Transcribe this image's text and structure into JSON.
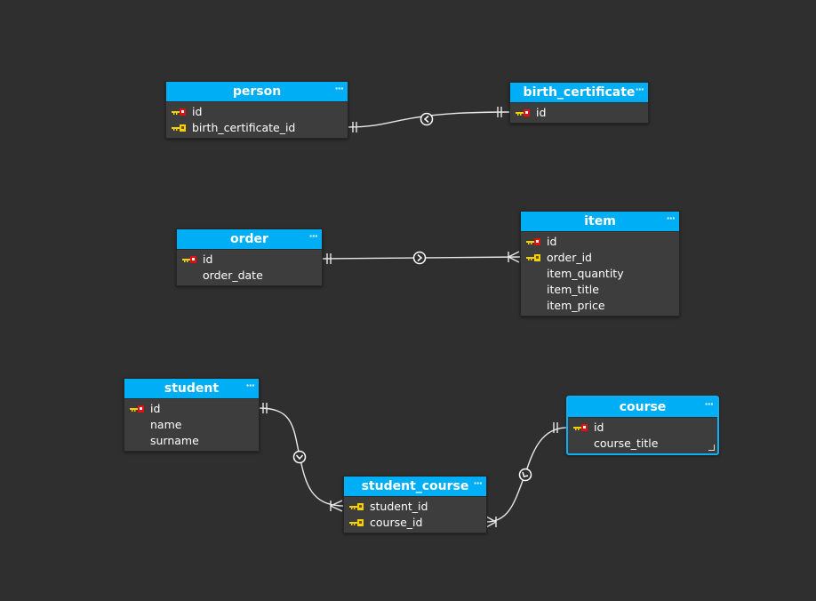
{
  "colors": {
    "background": "#2f2f2f",
    "table_header": "#00aef5",
    "table_body": "#3d3d3d",
    "primary_key": "#e01010",
    "foreign_key": "#f5d000",
    "selection": "#12aff0"
  },
  "tables": {
    "person": {
      "name": "person",
      "menu": "···",
      "columns": [
        {
          "name": "id",
          "key": "primary-key"
        },
        {
          "name": "birth_certificate_id",
          "key": "foreign-key"
        }
      ]
    },
    "birth_certificate": {
      "name": "birth_certificate",
      "menu": "···",
      "columns": [
        {
          "name": "id",
          "key": "primary-key"
        }
      ]
    },
    "order": {
      "name": "order",
      "menu": "···",
      "columns": [
        {
          "name": "id",
          "key": "primary-key"
        },
        {
          "name": "order_date",
          "key": ""
        }
      ]
    },
    "item": {
      "name": "item",
      "menu": "···",
      "columns": [
        {
          "name": "id",
          "key": "primary-key"
        },
        {
          "name": "order_id",
          "key": "foreign-key"
        },
        {
          "name": "item_quantity",
          "key": ""
        },
        {
          "name": "item_title",
          "key": ""
        },
        {
          "name": "item_price",
          "key": ""
        }
      ]
    },
    "student": {
      "name": "student",
      "menu": "···",
      "columns": [
        {
          "name": "id",
          "key": "primary-key"
        },
        {
          "name": "name",
          "key": ""
        },
        {
          "name": "surname",
          "key": ""
        }
      ]
    },
    "course": {
      "name": "course",
      "menu": "···",
      "selected": true,
      "columns": [
        {
          "name": "id",
          "key": "primary-key"
        },
        {
          "name": "course_title",
          "key": ""
        }
      ]
    },
    "student_course": {
      "name": "student_course",
      "menu": "···",
      "columns": [
        {
          "name": "student_id",
          "key": "foreign-key"
        },
        {
          "name": "course_id",
          "key": "foreign-key"
        }
      ]
    }
  },
  "relationships": [
    {
      "from": "person.birth_certificate_id",
      "to": "birth_certificate.id",
      "from_cardinality": "one",
      "to_cardinality": "one",
      "direction": "left"
    },
    {
      "from": "order.id",
      "to": "item.order_id",
      "from_cardinality": "one",
      "to_cardinality": "many",
      "direction": "right"
    },
    {
      "from": "student.id",
      "to": "student_course.student_id",
      "from_cardinality": "one",
      "to_cardinality": "many",
      "direction": "down"
    },
    {
      "from": "student_course.course_id",
      "to": "course.id",
      "from_cardinality": "many",
      "to_cardinality": "one",
      "direction": "left"
    }
  ]
}
